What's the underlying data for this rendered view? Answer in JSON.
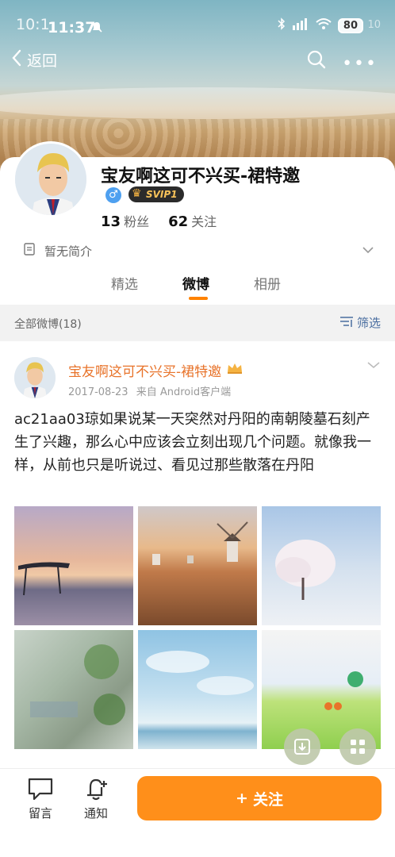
{
  "status": {
    "time_ghost": "10:1",
    "time": "11:37",
    "battery": "80",
    "battery_ghost": "10"
  },
  "nav": {
    "back_label": "返回"
  },
  "profile": {
    "name": "宝友啊这可不兴买-裙特邀",
    "gender": "♂",
    "vip_badge": "SVIP1",
    "fans_count": "13",
    "fans_label": "粉丝",
    "following_count": "62",
    "following_label": "关注",
    "intro": "暂无简介"
  },
  "tabs": [
    {
      "label": "精选"
    },
    {
      "label": "微博"
    },
    {
      "label": "相册"
    }
  ],
  "feed": {
    "all_label": "全部微博(18)",
    "filter_label": "筛选"
  },
  "post": {
    "author": "宝友啊这可不兴买-裙特邀",
    "date": "2017-08-23",
    "source": "来自 Android客户端",
    "text": "ac21aa03琼如果说某一天突然对丹阳的南朝陵墓石刻产生了兴趣，那么心中应该会立刻出现几个问题。就像我一样，从前也只是听说过、看见过那些散落在丹阳"
  },
  "bottom": {
    "comment_label": "留言",
    "notify_label": "通知",
    "follow_label": "关注",
    "follow_plus": "+"
  },
  "colors": {
    "accent": "#ff8200",
    "author": "#e8732a"
  }
}
